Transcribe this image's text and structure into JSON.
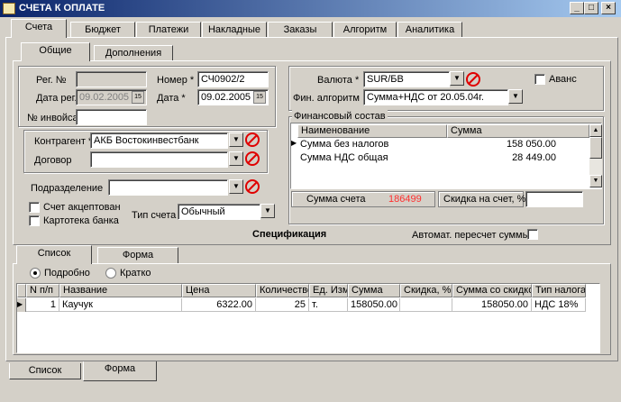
{
  "window": {
    "title": "СЧЕТА К ОПЛАТЕ",
    "min": "_",
    "max": "□",
    "close": "×"
  },
  "main_tabs": [
    "Счета",
    "Бюджет",
    "Платежи",
    "Накладные",
    "Заказы",
    "Алгоритм",
    "Аналитика"
  ],
  "sub_tabs": [
    "Общие",
    "Дополнения"
  ],
  "form": {
    "reg_no_label": "Рег. №",
    "reg_date_label": "Дата рег.",
    "reg_date_value": "09.02.2005",
    "invoice_no_label": "№ инвойса",
    "number_label": "Номер *",
    "number_value": "СЧ0902/2",
    "date_label": "Дата *",
    "date_value": "09.02.2005",
    "contractor_label": "Контрагент *",
    "contractor_value": "АКБ Востокинвестбанк",
    "contract_label": "Договор",
    "department_label": "Подразделение",
    "account_accepted_label": "Счет акцептован",
    "bank_card_label": "Картотека банка",
    "account_type_label": "Тип счета",
    "account_type_value": "Обычный",
    "currency_label": "Валюта *",
    "currency_value": "SUR/БВ",
    "advance_label": "Аванс",
    "fin_algo_label": "Фин. алгоритм",
    "fin_algo_value": "Сумма+НДС от 20.05.04г.",
    "cal_glyph": "15",
    "dd_glyph": "▼"
  },
  "finance": {
    "title": "Финансовый состав",
    "headers": [
      "Наименование",
      "Сумма"
    ],
    "rows": [
      {
        "name": "Сумма без налогов",
        "sum": "158 050.00"
      },
      {
        "name": "Сумма НДС общая",
        "sum": "28 449.00"
      }
    ],
    "total_label": "Сумма счета",
    "total_value": "186499",
    "discount_label": "Скидка на счет, %",
    "discount_value": "",
    "total_color": "#ff3030"
  },
  "spec": {
    "title": "Спецификация",
    "auto_recalc_label": "Автомат. пересчет суммы"
  },
  "spec_tabs": [
    "Список",
    "Форма"
  ],
  "view_mode": {
    "detailed": "Подробно",
    "brief": "Кратко"
  },
  "table": {
    "headers": [
      "N п/п",
      "Название",
      "Цена",
      "Количество",
      "Ед. Изм.",
      "Сумма",
      "Скидка, %",
      "Сумма со скидкой",
      "Тип налога"
    ],
    "rows": [
      {
        "n": "1",
        "name": "Каучук",
        "price": "6322.00",
        "qty": "25",
        "unit": "т.",
        "sum": "158050.00",
        "discount": "",
        "sum_disc": "158050.00",
        "tax": "НДС 18%"
      }
    ]
  },
  "bottom_tabs": [
    "Список",
    "Форма"
  ],
  "colors": {
    "titlebar": "#0a246a",
    "face": "#d4d0c8",
    "clear_icon": "#e00000"
  }
}
